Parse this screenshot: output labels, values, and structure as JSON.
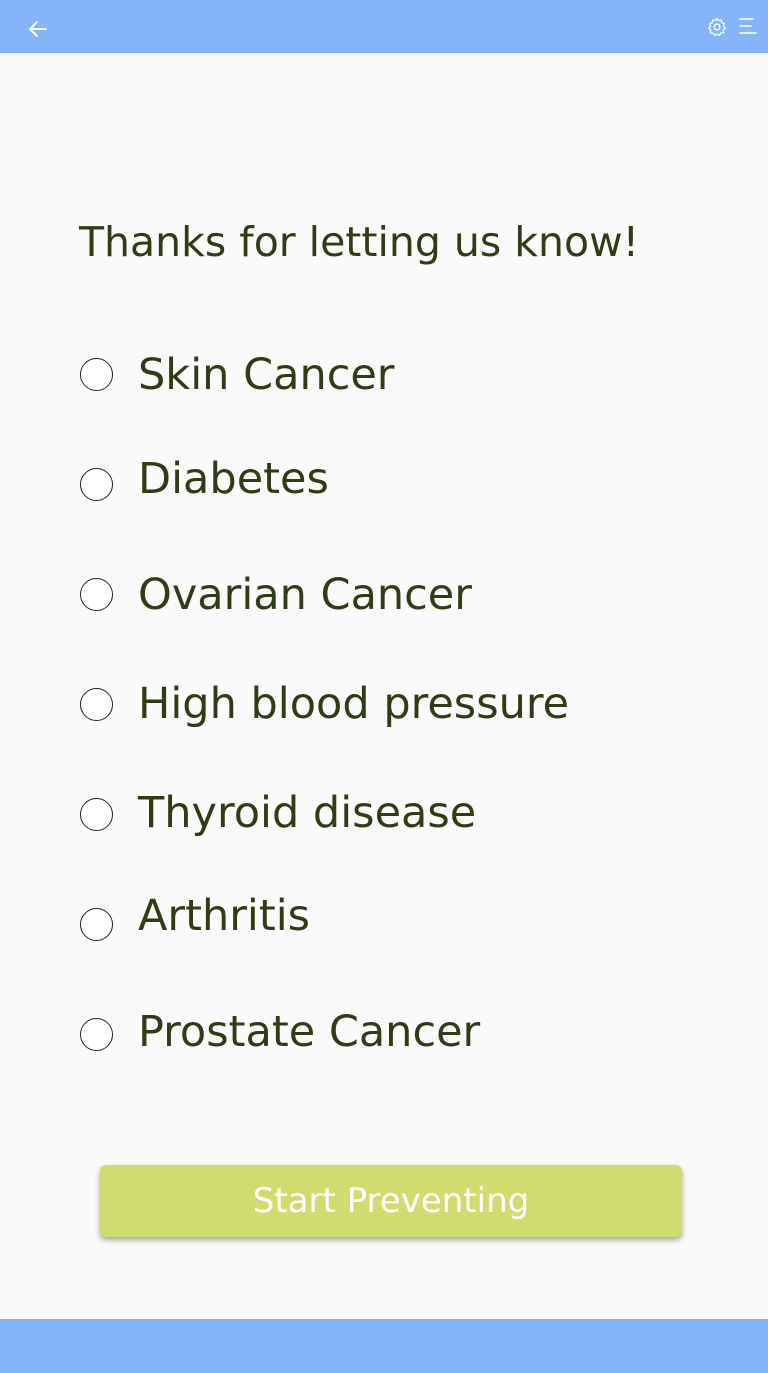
{
  "header": {
    "back_icon": "arrow-left-icon",
    "settings_icon": "gear-icon",
    "menu_icon": "menu-icon"
  },
  "main": {
    "title": "Thanks for letting us know!",
    "options": [
      {
        "label": "Skin Cancer",
        "selected": false
      },
      {
        "label": "Diabetes",
        "selected": false
      },
      {
        "label": "Ovarian Cancer",
        "selected": false
      },
      {
        "label": "High blood pressure",
        "selected": false
      },
      {
        "label": "Thyroid disease",
        "selected": false
      },
      {
        "label": "Arthritis",
        "selected": false
      },
      {
        "label": "Prostate Cancer",
        "selected": false
      }
    ],
    "start_button_label": "Start Preventing"
  },
  "colors": {
    "bar": "#86b4f8",
    "button": "#cfdd6e",
    "text": "#2f3d16",
    "background": "#fafafa"
  }
}
